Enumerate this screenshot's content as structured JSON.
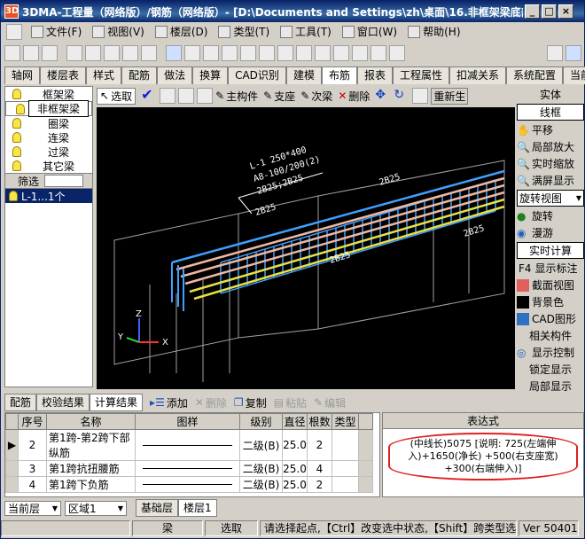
{
  "window": {
    "title": "3DMA-工程量（网络版）/钢筋（网络版）- [D:\\Documents and Settings\\zh\\桌面\\16.非框架梁底部...",
    "buttons": [
      "_",
      "□",
      "×"
    ]
  },
  "menu": [
    {
      "label": "文件(F)"
    },
    {
      "label": "视图(V)"
    },
    {
      "label": "楼层(D)"
    },
    {
      "label": "类型(T)"
    },
    {
      "label": "工具(T)"
    },
    {
      "label": "窗口(W)"
    },
    {
      "label": "帮助(H)"
    }
  ],
  "tabs": [
    "轴网",
    "楼层表",
    "样式",
    "配筋",
    "做法",
    "换算",
    "CAD识别",
    "建模",
    "布筋",
    "报表",
    "工程属性",
    "扣减关系",
    "系统配置",
    "当前构"
  ],
  "active_tab": "布筋",
  "left_panel": {
    "items": [
      "框架梁",
      "非框架梁",
      "圈梁",
      "连梁",
      "过梁",
      "其它梁"
    ],
    "selected": "非框架梁",
    "filter_label": "筛选",
    "tree_item": "L-1...1个"
  },
  "toolbar2": {
    "select": "选取",
    "main_member": "主构件",
    "support": "支座",
    "secondary_beam": "次梁",
    "delete": "删除",
    "regenerate": "重新生"
  },
  "viewport": {
    "beam_label_lines": [
      "L-1 250*400",
      "A8-100/200(2)",
      "2B25;2B25"
    ],
    "rebar_labels": [
      "2B25",
      "2B25",
      "2B25",
      "2B25"
    ],
    "axes": [
      "Z",
      "Y",
      "X"
    ],
    "colors": {
      "background": "#000000",
      "stirrups": "#3fa0ff",
      "longitudinal": "#f0b8a0",
      "bottom_bar": "#e8e048",
      "frame": "#a0a0a0"
    }
  },
  "right_panel": {
    "items": [
      "实体",
      "线框",
      "平移",
      "局部放大",
      "实时缩放",
      "满屏显示",
      "旋转视图",
      "旋转",
      "漫游",
      "实时计算",
      "显示标注",
      "截面视图",
      "背景色",
      "CAD图形",
      "相关构件",
      "显示控制",
      "锁定显示",
      "局部显示"
    ],
    "f4_key": "F4"
  },
  "bottom_tabs": {
    "tabs": [
      "配筋",
      "校验结果",
      "计算结果"
    ],
    "active": "计算结果",
    "tools": [
      {
        "label": "添加",
        "enabled": true
      },
      {
        "label": "删除",
        "enabled": false
      },
      {
        "label": "复制",
        "enabled": true
      },
      {
        "label": "粘贴",
        "enabled": false
      },
      {
        "label": "编辑",
        "enabled": false
      }
    ]
  },
  "table": {
    "headers": [
      "序号",
      "名称",
      "图样",
      "级别",
      "直径",
      "根数",
      "类型"
    ],
    "rows": [
      {
        "no": "2",
        "name": "第1跨-第2跨下部纵筋",
        "grade": "二级(B)",
        "dia": "25.0",
        "count": "2"
      },
      {
        "no": "3",
        "name": "第1跨抗扭腰筋",
        "grade": "二级(B)",
        "dia": "25.0",
        "count": "4"
      },
      {
        "no": "4",
        "name": "第1跨下负筋",
        "grade": "二级(B)",
        "dia": "25.0",
        "count": "2"
      }
    ]
  },
  "expression": {
    "header": "表达式",
    "text": "(中线长)5075 [说明: 725(左端伸入)+1650(净长) +500(右支座宽) +300(右端伸入)]"
  },
  "layer_bar": {
    "current_layer": "当前层",
    "region": "区域1",
    "tabs": [
      "基础层",
      "楼层1"
    ]
  },
  "status": {
    "member": "梁",
    "mode": "选取",
    "hint": "请选择起点,【Ctrl】改变选中状态,【Shift】跨类型选取",
    "version": "Ver 50401"
  }
}
